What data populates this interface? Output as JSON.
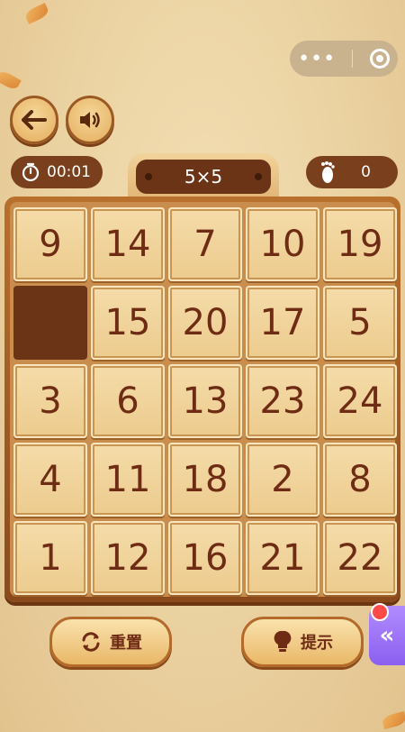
{
  "capsule": {
    "more_icon": "ellipsis-icon",
    "close_icon": "target-icon"
  },
  "toolbar": {
    "back_icon": "arrow-left-icon",
    "sound_icon": "speaker-icon"
  },
  "stats": {
    "timer": "00:01",
    "steps": "0",
    "board_size": "5×5"
  },
  "board": {
    "rows": [
      [
        "9",
        "14",
        "7",
        "10",
        "19"
      ],
      [
        "",
        "15",
        "20",
        "17",
        "5"
      ],
      [
        "3",
        "6",
        "13",
        "23",
        "24"
      ],
      [
        "4",
        "11",
        "18",
        "2",
        "8"
      ],
      [
        "1",
        "12",
        "16",
        "21",
        "22"
      ]
    ]
  },
  "buttons": {
    "reset_label": "重置",
    "hint_label": "提示",
    "side_label": "«"
  },
  "colors": {
    "board_wood": "#8a4a1b",
    "tile_text": "#6f2c14",
    "empty_tile": "#6b3417",
    "side_tab": "#8c5ff0"
  }
}
